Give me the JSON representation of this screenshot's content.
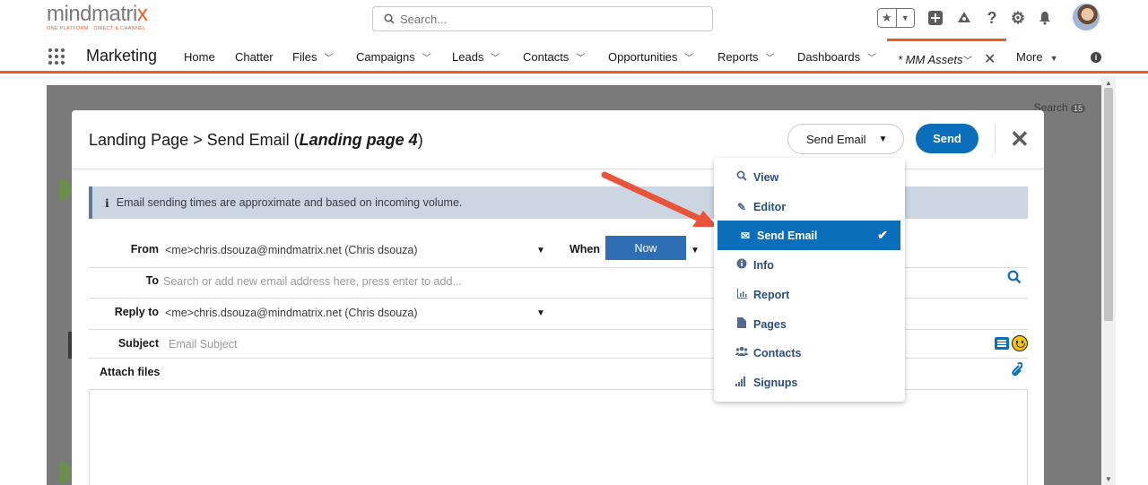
{
  "header": {
    "logo_text": "mindmatrix",
    "logo_tagline": "ONE PLATFORM · DIRECT & CHANNEL",
    "search_placeholder": "Search..."
  },
  "nav": {
    "app_name": "Marketing",
    "items": [
      {
        "label": "Home",
        "chevron": false
      },
      {
        "label": "Chatter",
        "chevron": false
      },
      {
        "label": "Files",
        "chevron": true
      },
      {
        "label": "Campaigns",
        "chevron": true
      },
      {
        "label": "Leads",
        "chevron": true
      },
      {
        "label": "Contacts",
        "chevron": true
      },
      {
        "label": "Opportunities",
        "chevron": true
      },
      {
        "label": "Reports",
        "chevron": true
      },
      {
        "label": "Dashboards",
        "chevron": true
      }
    ],
    "active_tab": "* MM Assets",
    "more_label": "More"
  },
  "backdrop": {
    "search_peek": "Search",
    "search_badge": "15"
  },
  "modal": {
    "title_prefix": "Landing Page > Send Email (",
    "title_italic": "Landing page 4",
    "title_suffix": ")",
    "view_select": "Send Email",
    "send_label": "Send",
    "banner_text": "Email sending times are approximate and based on incoming volume.",
    "from_label": "From",
    "from_value": "<me>chris.dsouza@mindmatrix.net (Chris dsouza)",
    "when_label": "When",
    "when_value": "Now",
    "to_label": "To",
    "to_placeholder": "Search or add new email address here, press enter to add...",
    "reply_label": "Reply to",
    "reply_value": "<me>chris.dsouza@mindmatrix.net (Chris dsouza)",
    "subject_label": "Subject",
    "subject_placeholder": "Email Subject",
    "attach_label": "Attach files"
  },
  "dropdown": {
    "items": [
      {
        "label": "View",
        "icon": "search-icon",
        "glyph": "⚲"
      },
      {
        "label": "Editor",
        "icon": "edit-icon",
        "glyph": "✎"
      },
      {
        "label": "Send Email",
        "icon": "envelope-icon",
        "glyph": "✉",
        "active": true
      },
      {
        "label": "Info",
        "icon": "info-icon",
        "glyph": "ⓘ"
      },
      {
        "label": "Report",
        "icon": "chart-icon",
        "glyph": "▥"
      },
      {
        "label": "Pages",
        "icon": "page-icon",
        "glyph": "▮"
      },
      {
        "label": "Contacts",
        "icon": "people-icon",
        "glyph": "☻"
      },
      {
        "label": "Signups",
        "icon": "signal-icon",
        "glyph": "▂▄▆"
      }
    ]
  },
  "colors": {
    "accent": "#f05a22",
    "primary": "#0b6ebb",
    "banner": "#ccd6e2",
    "overlay": "#7a7a7a"
  }
}
